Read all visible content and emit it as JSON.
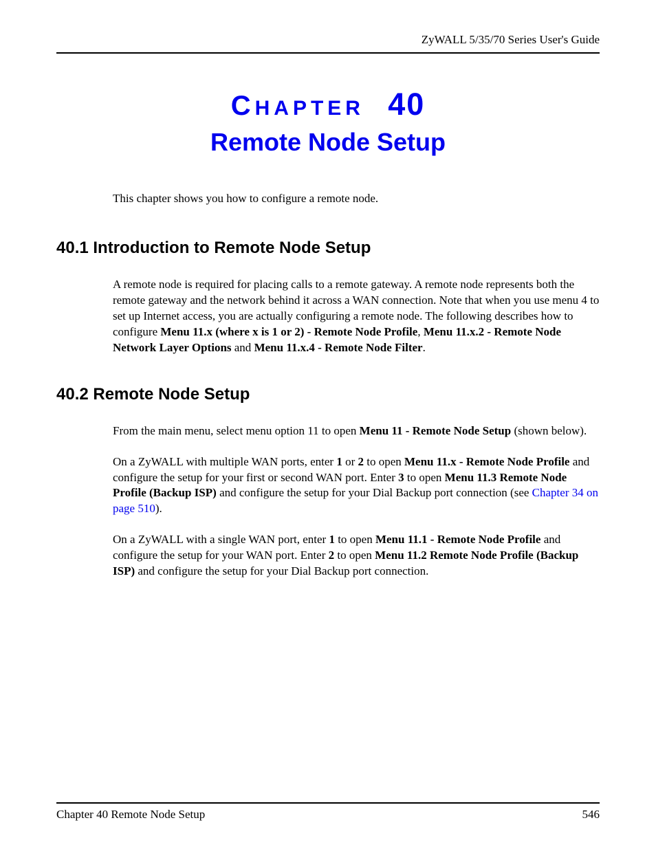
{
  "header": {
    "guide_title": "ZyWALL 5/35/70 Series User's Guide"
  },
  "chapter": {
    "label_first_letter": "C",
    "label_rest": "HAPTER",
    "number": "40",
    "title": "Remote Node Setup"
  },
  "intro": "This chapter shows you how to configure a remote node.",
  "section1": {
    "heading": "40.1  Introduction to Remote Node Setup",
    "p1_a": "A remote node is required for placing calls to a remote gateway. A remote node represents both the remote gateway and the network behind it across a WAN connection. Note that when you use menu 4 to set up Internet access, you are actually configuring a remote node. The following describes how to configure ",
    "p1_b1": "Menu 11.x (where x is 1 or 2) - Remote Node Profile",
    "p1_c": ", ",
    "p1_b2": "Menu 11.x.2 - Remote Node Network Layer Options",
    "p1_d": " and ",
    "p1_b3": "Menu 11.x.4 - Remote Node Filter",
    "p1_e": "."
  },
  "section2": {
    "heading": "40.2  Remote Node Setup",
    "p1_a": "From the main menu, select menu option 11 to open ",
    "p1_b1": "Menu 11 - Remote Node Setup",
    "p1_c": " (shown below).",
    "p2_a": "On a ZyWALL with multiple WAN ports, enter ",
    "p2_b1": "1",
    "p2_b": " or ",
    "p2_b2": "2",
    "p2_c": " to open ",
    "p2_b3": "Menu 11.x - Remote Node Profile",
    "p2_d": " and configure the setup for your first or second WAN port. Enter ",
    "p2_b4": "3",
    "p2_e": " to open ",
    "p2_b5": "Menu 11.3 Remote Node Profile (Backup ISP)",
    "p2_f": " and configure the setup for your Dial Backup port connection (see ",
    "p2_link": "Chapter 34 on page 510",
    "p2_g": ").",
    "p3_a": "On a ZyWALL with a single WAN port, enter ",
    "p3_b1": "1",
    "p3_b": " to open ",
    "p3_b2": "Menu 11.1 - Remote Node Profile",
    "p3_c": " and configure the setup for your WAN port. Enter ",
    "p3_b3": "2",
    "p3_d": " to open ",
    "p3_b4": "Menu 11.2 Remote Node Profile (Backup ISP)",
    "p3_e": " and configure the setup for your Dial Backup port connection."
  },
  "footer": {
    "left": "Chapter 40 Remote Node Setup",
    "right": "546"
  }
}
